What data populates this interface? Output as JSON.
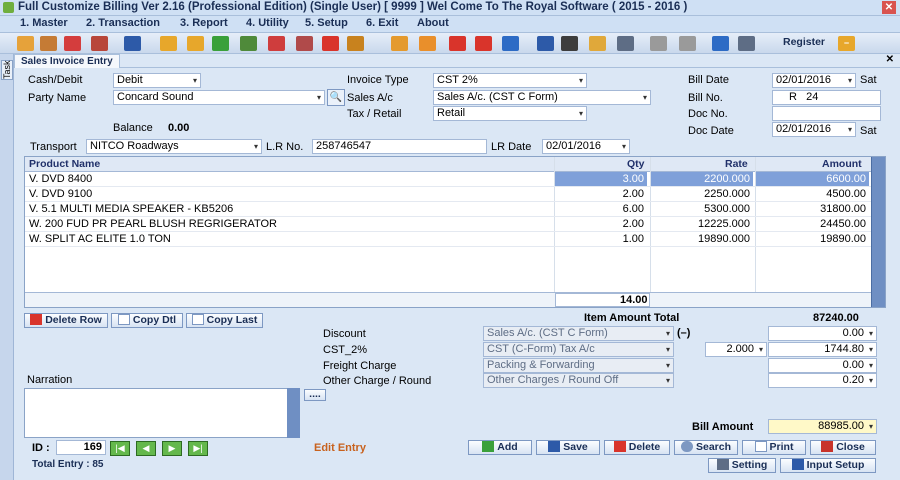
{
  "window": {
    "title": "Full Customize Billing Ver 2.16 (Professional Edition) (Single User)     [ 9999 ] Wel Come To The Royal Software ( 2015 - 2016 )"
  },
  "menu": [
    "1. Master",
    "2. Transaction",
    "3. Report",
    "4. Utility",
    "5. Setup",
    "6. Exit",
    "About"
  ],
  "toolbar": {
    "register_label": "Register"
  },
  "side": {
    "task_label": "Task"
  },
  "form_title": "Sales Invoice Entry",
  "header": {
    "cash_debit_label": "Cash/Debit",
    "cash_debit_value": "Debit",
    "party_label": "Party Name",
    "party_value": "Concard Sound",
    "balance_label": "Balance",
    "balance_value": "0.00",
    "invoice_type_label": "Invoice Type",
    "invoice_type_value": "CST 2%",
    "sales_ac_label": "Sales A/c",
    "sales_ac_value": "Sales A/c. (CST C Form)",
    "tax_retail_label": "Tax / Retail",
    "tax_retail_value": "Retail",
    "bill_date_label": "Bill Date",
    "bill_date_value": "02/01/2016",
    "bill_day": "Sat",
    "bill_no_label": "Bill No.",
    "bill_no_value": "R   24",
    "doc_no_label": "Doc No.",
    "doc_no_value": "",
    "doc_date_label": "Doc Date",
    "doc_date_value": "02/01/2016",
    "doc_day": "Sat",
    "transport_label": "Transport",
    "transport_value": "NITCO Roadways",
    "lr_no_label": "L.R No.",
    "lr_no_value": "258746547",
    "lr_date_label": "LR Date",
    "lr_date_value": "02/01/2016"
  },
  "grid": {
    "columns": [
      "Product Name",
      "Qty",
      "Rate",
      "Amount"
    ],
    "rows": [
      {
        "name": "V. DVD  8400",
        "qty": "3.00",
        "rate": "2200.000",
        "amount": "6600.00"
      },
      {
        "name": "V. DVD  9100",
        "qty": "2.00",
        "rate": "2250.000",
        "amount": "4500.00"
      },
      {
        "name": "V. 5.1 MULTI MEDIA SPEAKER - KB5206",
        "qty": "6.00",
        "rate": "5300.000",
        "amount": "31800.00"
      },
      {
        "name": "W. 200 FUD PR PEARL BLUSH REGRIGERATOR",
        "qty": "2.00",
        "rate": "12225.000",
        "amount": "24450.00"
      },
      {
        "name": "W. SPLIT AC ELITE 1.0 TON",
        "qty": "1.00",
        "rate": "19890.000",
        "amount": "19890.00"
      }
    ],
    "total_qty": "14.00"
  },
  "row_buttons": {
    "delete_row": "Delete Row",
    "copy_dtl": "Copy Dtl",
    "copy_last": "Copy Last"
  },
  "totals": {
    "item_amount_label": "Item Amount Total",
    "item_amount_value": "87240.00",
    "discount_label": "Discount",
    "discount_ac": "Sales A/c. (CST C Form)",
    "discount_sign": "(–)",
    "discount_value": "0.00",
    "cst_label": "CST_2%",
    "cst_ac": "CST (C-Form) Tax A/c",
    "cst_rate": "2.000",
    "cst_value": "1744.80",
    "freight_label": "Freight Charge",
    "freight_ac": "Packing & Forwarding",
    "freight_value": "0.00",
    "other_label": "Other Charge / Round",
    "other_ac": "Other Charges / Round Off",
    "other_value": "0.20",
    "bill_amount_label": "Bill Amount",
    "bill_amount_value": "88985.00"
  },
  "narration": {
    "label": "Narration",
    "more": "....",
    "value": ""
  },
  "footer": {
    "id_label": "ID :",
    "id_value": "169",
    "mode": "Edit Entry",
    "total_entry": "Total Entry : 85"
  },
  "actions": {
    "add": "Add",
    "save": "Save",
    "delete": "Delete",
    "search": "Search",
    "print": "Print",
    "close": "Close",
    "setting": "Setting",
    "input_setup": "Input Setup"
  },
  "colors": {
    "selection": "#7fa0d9",
    "grid_scroll": "#6f8fc3",
    "mode_text": "#c8621e",
    "bill_amount_bg": "#fff9c8"
  },
  "toolbar_icons": [
    "user-icon",
    "box-icon",
    "help-icon",
    "calendar-icon",
    "book-icon",
    "remove-icon",
    "add-icon",
    "add-item-icon",
    "hand-icon",
    "minus-icon",
    "pen-icon",
    "dd-icon",
    "list-icon",
    "cart-icon",
    "tag-icon",
    "cart-remove-icon",
    "tag-remove-icon",
    "q-icon",
    "notebook-icon",
    "d-icon",
    "folder-icon",
    "safe-icon",
    "coins-remove-icon",
    "coins-add-icon",
    "monitor-icon",
    "desk-icon"
  ]
}
